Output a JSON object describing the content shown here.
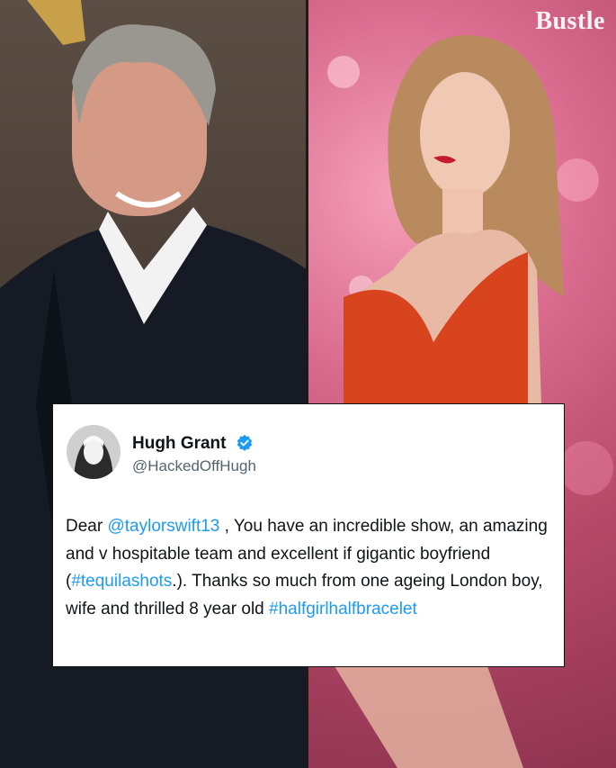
{
  "watermark": {
    "text": "Bustle"
  },
  "tweet": {
    "author_name": "Hugh Grant",
    "author_handle": "@HackedOffHugh",
    "verified_icon": "verified-badge-icon",
    "avatar_icon": "profile-avatar",
    "body": {
      "t1": "Dear ",
      "mention": "@taylorswift13",
      "t2": " , You have an incredible show, an amazing and v hospitable team and excellent if gigantic boyfriend (",
      "hashtag1": "#tequilashots",
      "t3": ".). Thanks so much from one ageing London boy, wife and thrilled 8 year old ",
      "hashtag2": "#halfgirlhalfbracelet"
    }
  },
  "colors": {
    "link": "#1d9bf0",
    "verified": "#1d9bf0",
    "handle": "#536471",
    "text": "#0f1419"
  }
}
